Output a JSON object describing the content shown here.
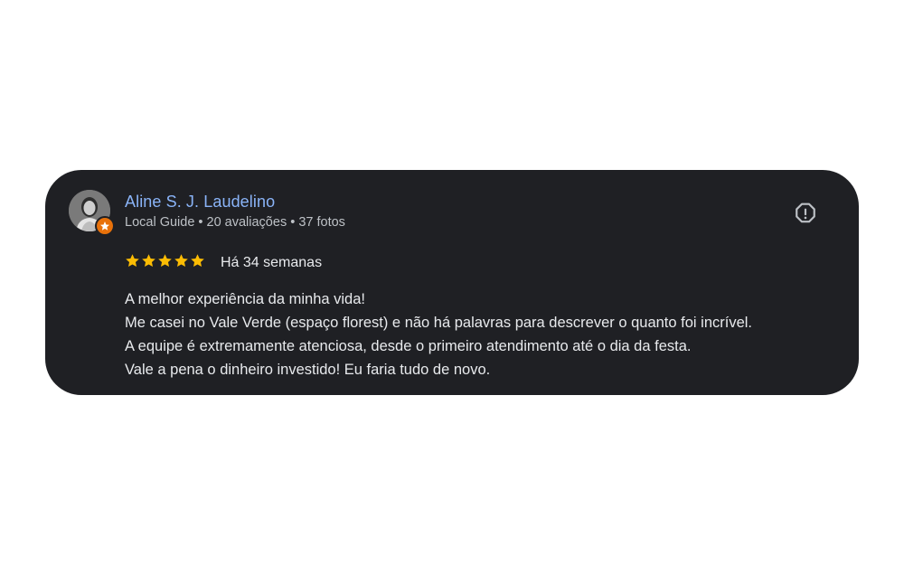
{
  "review": {
    "author_name": "Aline S. J. Laudelino",
    "author_meta": "Local Guide • 20 avaliações • 37 fotos",
    "rating": 5,
    "rating_max": 5,
    "date": "Há 34 semanas",
    "lines": [
      "A melhor experiência da minha vida!",
      "Me casei no Vale Verde (espaço florest) e não há palavras para descrever o quanto foi incrível.",
      "A equipe é extremamente atenciosa, desde o primeiro atendimento até o dia da festa.",
      "Vale a pena o dinheiro investido! Eu faria tudo de novo."
    ]
  },
  "icons": {
    "report": "report-icon",
    "star": "star-icon",
    "local_guide_badge": "local-guide-badge-icon",
    "avatar": "avatar"
  },
  "colors": {
    "card_background": "#1f2024",
    "author_name": "#8ab4f8",
    "star": "#fbbc04",
    "badge": "#e8710a",
    "text": "#e8eaed",
    "meta_text": "#bdc1c6"
  }
}
